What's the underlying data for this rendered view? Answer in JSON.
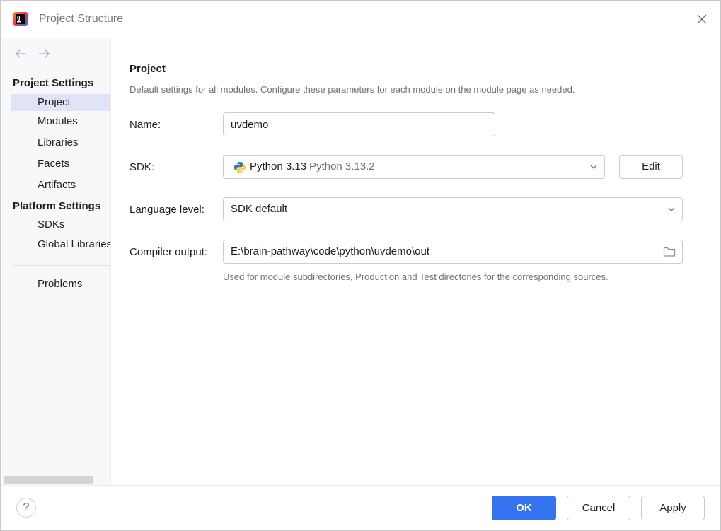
{
  "window": {
    "title": "Project Structure"
  },
  "sidebar": {
    "project_settings_header": "Project Settings",
    "project_items": [
      "Project",
      "Modules",
      "Libraries",
      "Facets",
      "Artifacts"
    ],
    "platform_settings_header": "Platform Settings",
    "platform_items": [
      "SDKs",
      "Global Libraries"
    ],
    "problems": "Problems",
    "selected": "Project"
  },
  "main": {
    "title": "Project",
    "description": "Default settings for all modules. Configure these parameters for each module on the module page as needed.",
    "name_label": "Name:",
    "name_value": "uvdemo",
    "sdk_label": "SDK:",
    "sdk_name": "Python 3.13",
    "sdk_version": "Python 3.13.2",
    "edit_label": "Edit",
    "language_level_label_prefix": "L",
    "language_level_label_rest": "anguage level:",
    "language_level_value": "SDK default",
    "compiler_output_label": "Compiler output:",
    "compiler_output_value": "E:\\brain-pathway\\code\\python\\uvdemo\\out",
    "compiler_output_hint": "Used for module subdirectories, Production and Test directories for the corresponding sources."
  },
  "footer": {
    "help": "?",
    "ok": "OK",
    "cancel": "Cancel",
    "apply": "Apply"
  },
  "colors": {
    "accent": "#3574f0",
    "selection": "#dfe5f7",
    "secondary_text": "#6c707e"
  }
}
